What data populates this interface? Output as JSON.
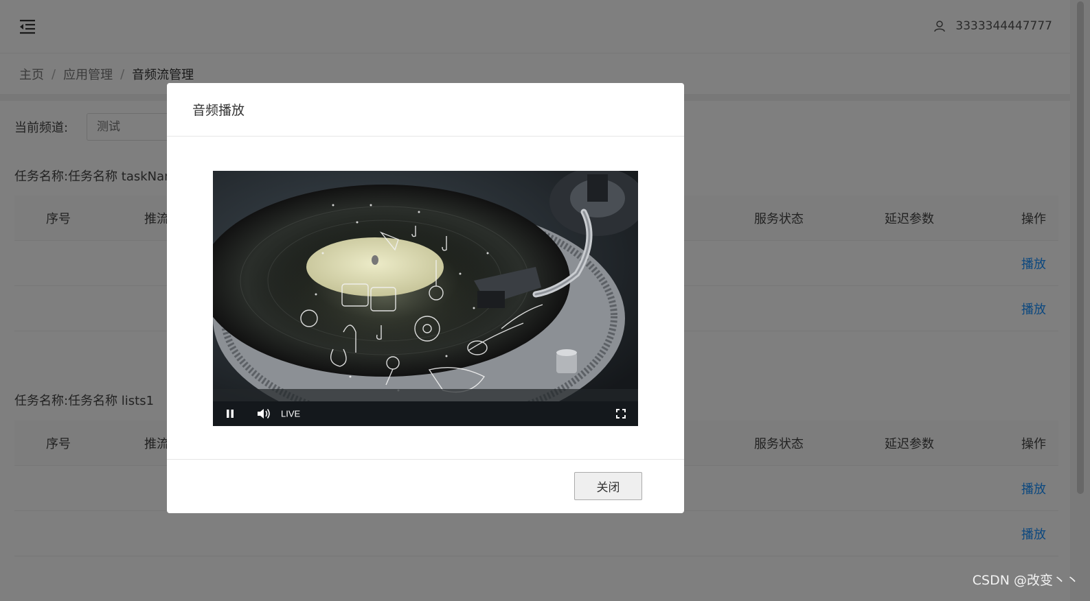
{
  "header": {
    "username": "3333344447777"
  },
  "breadcrumb": {
    "items": [
      "主页",
      "应用管理",
      "音频流管理"
    ],
    "separator": "/"
  },
  "filter": {
    "channel_label": "当前频道:",
    "channel_placeholder": "测试"
  },
  "tasks": [
    {
      "title": "任务名称:任务名称 taskNam",
      "columns": [
        "序号",
        "推流",
        "服务状态",
        "延迟参数",
        "操作"
      ],
      "rows": [
        {
          "action": "播放"
        },
        {
          "action": "播放"
        }
      ]
    },
    {
      "title": "任务名称:任务名称 lists1",
      "columns": [
        "序号",
        "推流",
        "服务状态",
        "延迟参数",
        "操作"
      ],
      "rows": [
        {
          "action": "播放"
        },
        {
          "action": "播放"
        }
      ]
    }
  ],
  "modal": {
    "title": "音频播放",
    "close_label": "关闭",
    "player": {
      "live_label": "LIVE",
      "icons": [
        "pause-icon",
        "volume-icon",
        "fullscreen-icon"
      ]
    }
  },
  "watermark": "CSDN @改变丶丶",
  "colors": {
    "link": "#1890ff",
    "overlay": "rgba(0,0,0,0.5)"
  }
}
